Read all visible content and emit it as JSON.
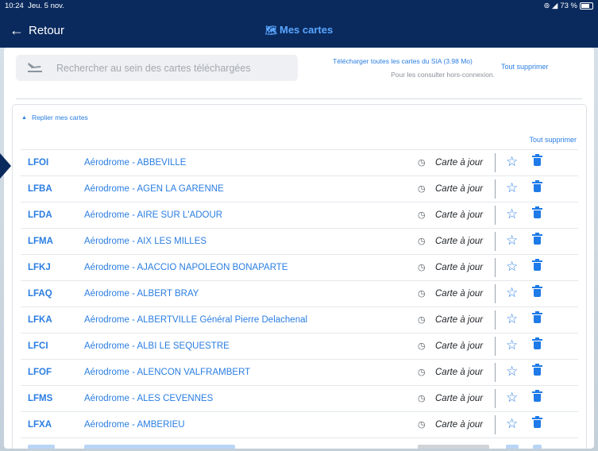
{
  "status_bar": {
    "time": "10:24",
    "date": "Jeu. 5 nov.",
    "battery_text": "73 %"
  },
  "nav": {
    "back_label": "Retour",
    "title": "Mes cartes"
  },
  "search": {
    "placeholder": "Rechercher au sein des cartes téléchargées"
  },
  "download": {
    "link": "Télécharger toutes les cartes du SIA (3.98 Mo)",
    "subtitle": "Pour les consulter hors-connexion."
  },
  "delete_all_label": "Tout supprimer",
  "section": {
    "collapse_label": "Replier mes cartes",
    "delete_all_label": "Tout supprimer"
  },
  "colors": {
    "nav_bg": "#0a2a5e",
    "accent": "#2a7de1",
    "title": "#5aa6ff"
  },
  "rows": [
    {
      "code": "LFOI",
      "name": "Aérodrome - ABBEVILLE",
      "status": "Carte à jour"
    },
    {
      "code": "LFBA",
      "name": "Aérodrome - AGEN LA GARENNE",
      "status": "Carte à jour"
    },
    {
      "code": "LFDA",
      "name": "Aérodrome - AIRE SUR L'ADOUR",
      "status": "Carte à jour"
    },
    {
      "code": "LFMA",
      "name": "Aérodrome - AIX LES MILLES",
      "status": "Carte à jour"
    },
    {
      "code": "LFKJ",
      "name": "Aérodrome - AJACCIO NAPOLEON BONAPARTE",
      "status": "Carte à jour"
    },
    {
      "code": "LFAQ",
      "name": "Aérodrome - ALBERT BRAY",
      "status": "Carte à jour"
    },
    {
      "code": "LFKA",
      "name": "Aérodrome - ALBERTVILLE Général Pierre Delachenal",
      "status": "Carte à jour"
    },
    {
      "code": "LFCI",
      "name": "Aérodrome - ALBI LE SEQUESTRE",
      "status": "Carte à jour"
    },
    {
      "code": "LFOF",
      "name": "Aérodrome - ALENCON VALFRAMBERT",
      "status": "Carte à jour"
    },
    {
      "code": "LFMS",
      "name": "Aérodrome - ALES CEVENNES",
      "status": "Carte à jour"
    },
    {
      "code": "LFXA",
      "name": "Aérodrome - AMBERIEU",
      "status": "Carte à jour"
    }
  ]
}
